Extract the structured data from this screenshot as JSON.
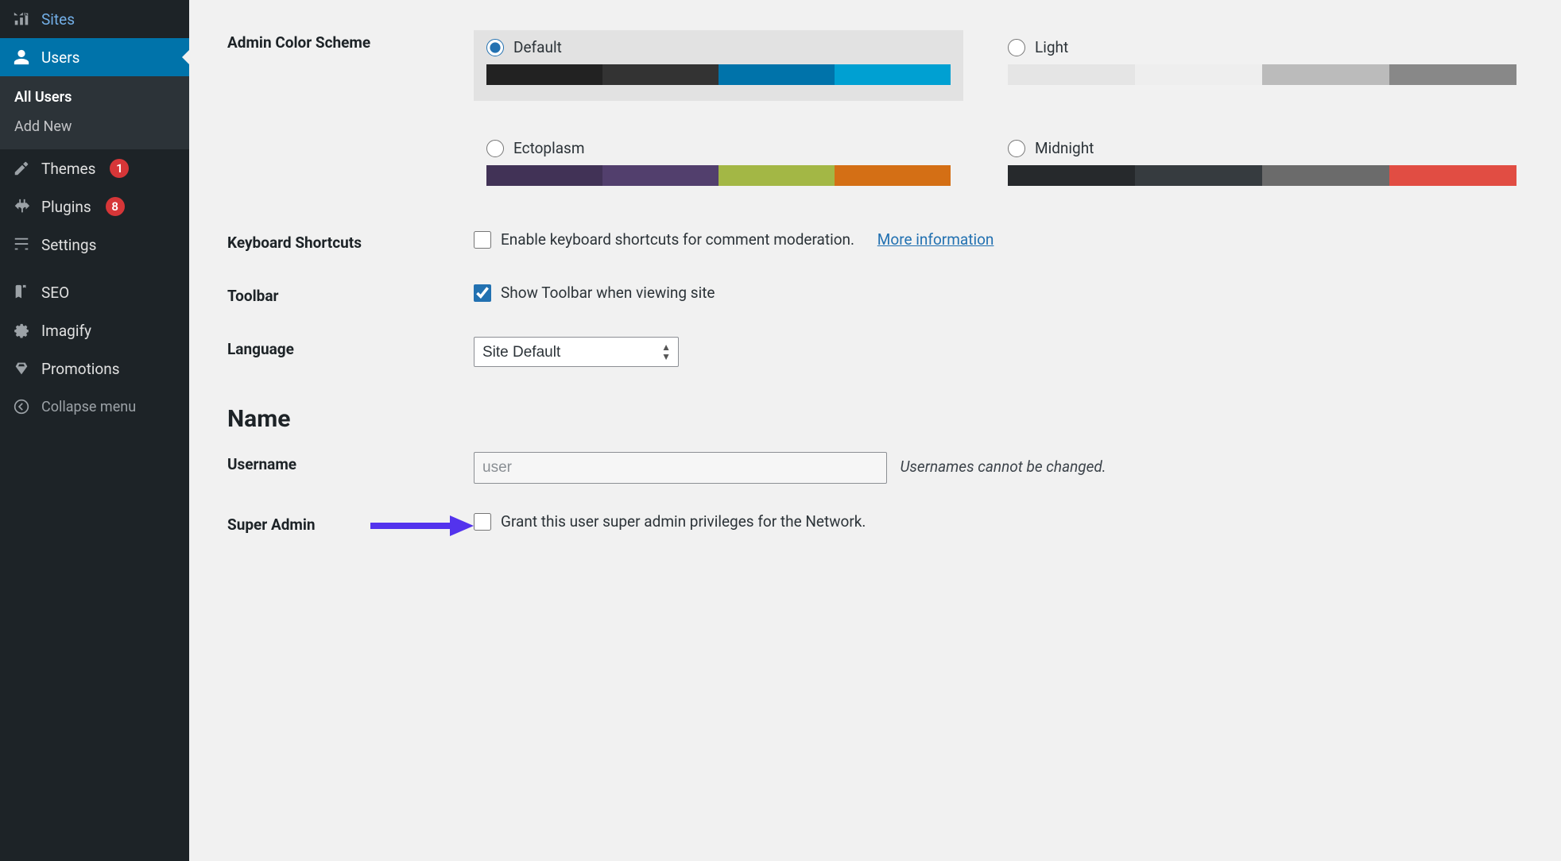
{
  "sidebar": {
    "items": [
      {
        "label": "Sites"
      },
      {
        "label": "Users"
      },
      {
        "label": "Themes",
        "badge": "1"
      },
      {
        "label": "Plugins",
        "badge": "8"
      },
      {
        "label": "Settings"
      },
      {
        "label": "SEO"
      },
      {
        "label": "Imagify"
      },
      {
        "label": "Promotions"
      }
    ],
    "submenu": [
      {
        "label": "All Users"
      },
      {
        "label": "Add New"
      }
    ],
    "collapse_label": "Collapse menu"
  },
  "form": {
    "color_scheme_label": "Admin Color Scheme",
    "schemes": {
      "default": {
        "name": "Default",
        "colors": [
          "#222222",
          "#333333",
          "#0073aa",
          "#00a0d2"
        ]
      },
      "light": {
        "name": "Light",
        "colors": [
          "#e5e5e5",
          "#eeeeee",
          "#bbbbbb",
          "#888888"
        ]
      },
      "ectoplasm": {
        "name": "Ectoplasm",
        "colors": [
          "#413256",
          "#523f6d",
          "#a3b745",
          "#d46f15"
        ]
      },
      "midnight": {
        "name": "Midnight",
        "colors": [
          "#26292c",
          "#363b3f",
          "#6b6b6b",
          "#e14d43"
        ]
      }
    },
    "keyboard_label": "Keyboard Shortcuts",
    "keyboard_check": "Enable keyboard shortcuts for comment moderation.",
    "keyboard_more": "More information",
    "toolbar_label": "Toolbar",
    "toolbar_check": "Show Toolbar when viewing site",
    "language_label": "Language",
    "language_value": "Site Default",
    "name_heading": "Name",
    "username_label": "Username",
    "username_value": "user",
    "username_hint": "Usernames cannot be changed.",
    "superadmin_label": "Super Admin",
    "superadmin_check": "Grant this user super admin privileges for the Network."
  }
}
